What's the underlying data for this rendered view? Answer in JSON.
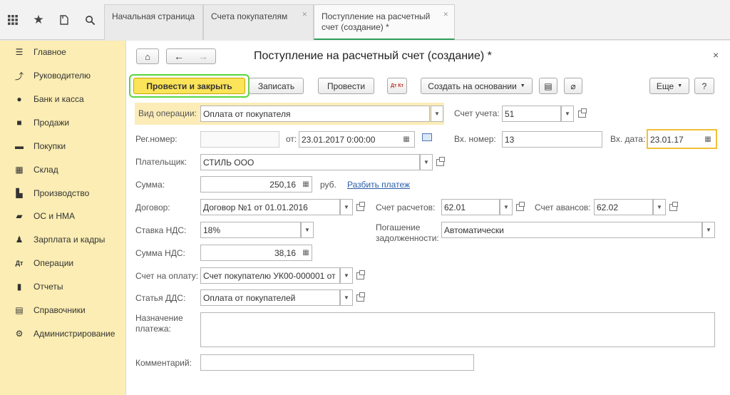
{
  "topbar": {
    "icons": [
      "grid-icon",
      "star-icon",
      "history-icon",
      "search-icon"
    ],
    "tabs": [
      {
        "label": "Начальная страница"
      },
      {
        "label": "Счета покупателям"
      },
      {
        "label": "Поступление на расчетный счет (создание) *"
      }
    ]
  },
  "sidebar": {
    "items": [
      {
        "label": "Главное",
        "icon": "menu-icon"
      },
      {
        "label": "Руководителю",
        "icon": "trend-icon"
      },
      {
        "label": "Банк и касса",
        "icon": "ruble-icon"
      },
      {
        "label": "Продажи",
        "icon": "bag-icon"
      },
      {
        "label": "Покупки",
        "icon": "cart-icon"
      },
      {
        "label": "Склад",
        "icon": "warehouse-icon"
      },
      {
        "label": "Производство",
        "icon": "factory-icon"
      },
      {
        "label": "ОС и НМА",
        "icon": "truck-icon"
      },
      {
        "label": "Зарплата и кадры",
        "icon": "person-icon"
      },
      {
        "label": "Операции",
        "icon": "dt-kt-icon"
      },
      {
        "label": "Отчеты",
        "icon": "bar-chart-icon"
      },
      {
        "label": "Справочники",
        "icon": "book-icon"
      },
      {
        "label": "Администрирование",
        "icon": "gear-icon"
      }
    ]
  },
  "form": {
    "title": "Поступление на расчетный счет (создание) *",
    "close": "×",
    "buttons": {
      "post_close": "Провести и закрыть",
      "save": "Записать",
      "post": "Провести",
      "create_based": "Создать на основании",
      "more": "Еще",
      "help": "?",
      "dtkt": "Дт Кт"
    },
    "fields": {
      "op_type": {
        "label": "Вид операции:",
        "value": "Оплата от покупателя"
      },
      "account": {
        "label": "Счет учета:",
        "value": "51"
      },
      "reg_number": {
        "label": "Рег.номер:",
        "value": ""
      },
      "from": {
        "label": "от:",
        "value": "23.01.2017  0:00:00"
      },
      "in_number": {
        "label": "Вх. номер:",
        "value": "13"
      },
      "in_date": {
        "label": "Вх. дата:",
        "value": "23.01.17"
      },
      "payer": {
        "label": "Плательщик:",
        "value": "СТИЛЬ ООО"
      },
      "sum": {
        "label": "Сумма:",
        "value": "250,16",
        "unit": "руб.",
        "split_link": "Разбить платеж"
      },
      "contract": {
        "label": "Договор:",
        "value": "Договор №1 от 01.01.2016"
      },
      "settle_account": {
        "label": "Счет расчетов:",
        "value": "62.01"
      },
      "advance_account": {
        "label": "Счет авансов:",
        "value": "62.02"
      },
      "vat_rate": {
        "label": "Ставка НДС:",
        "value": "18%"
      },
      "debt_repay": {
        "label_1": "Погашение",
        "label_2": "задолженности:",
        "value": "Автоматически"
      },
      "vat_sum": {
        "label": "Сумма НДС:",
        "value": "38,16"
      },
      "invoice": {
        "label": "Счет на оплату:",
        "value": "Счет покупателю УК00-000001 от"
      },
      "dds_item": {
        "label": "Статья ДДС:",
        "value": "Оплата от покупателей"
      },
      "purpose": {
        "label_1": "Назначение",
        "label_2": "платежа:",
        "value": ""
      },
      "comment": {
        "label": "Комментарий:",
        "value": ""
      }
    }
  }
}
